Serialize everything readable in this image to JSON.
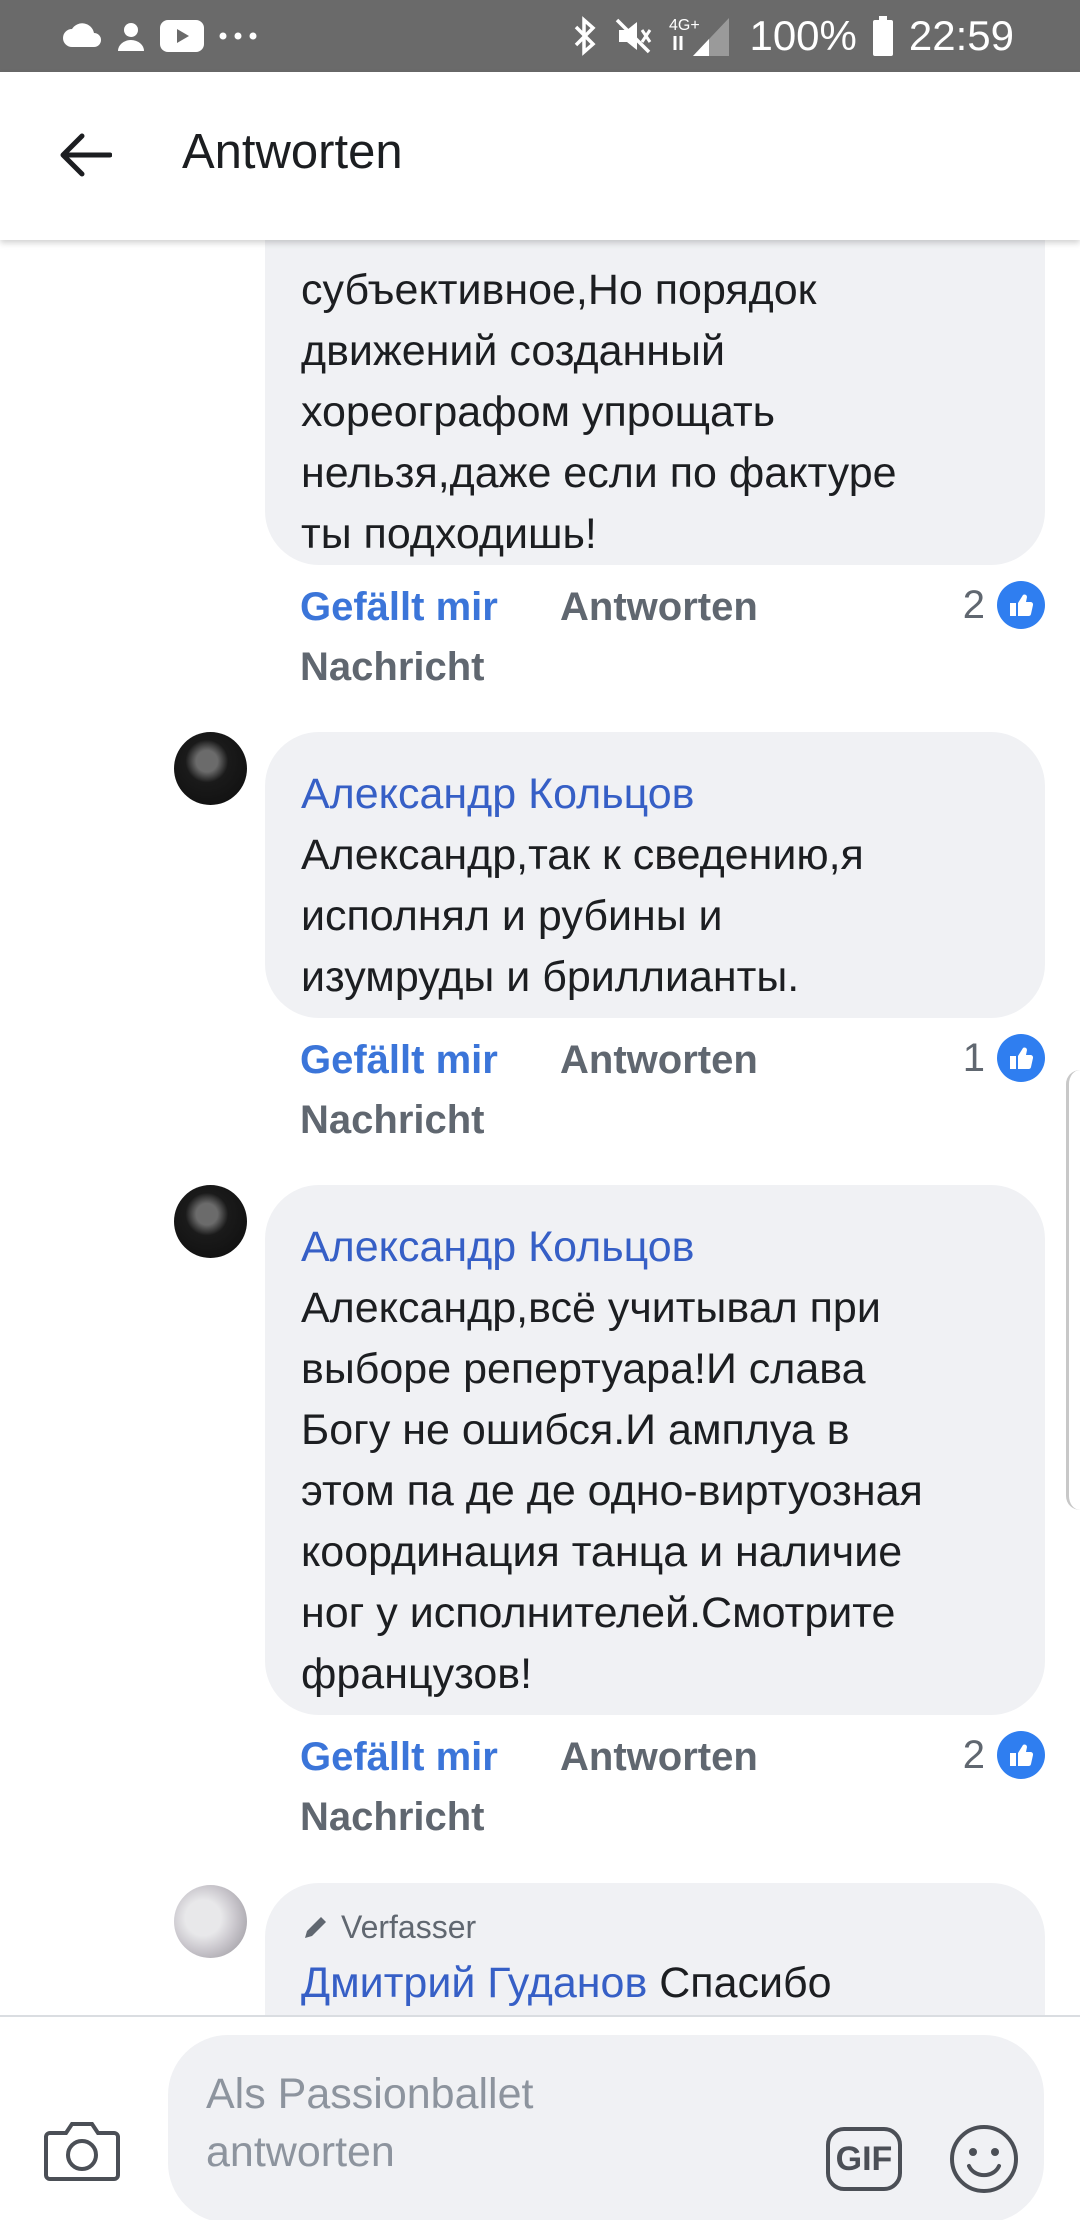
{
  "status_bar": {
    "network": "4G+",
    "battery": "100%",
    "time": "22:59",
    "left_icons": [
      "cloud-icon",
      "person-icon",
      "youtube-icon",
      "more-icon"
    ],
    "right_icons": [
      "bluetooth-icon",
      "mute-icon",
      "signal-icon",
      "battery-icon"
    ]
  },
  "header": {
    "title": "Antworten"
  },
  "comments": [
    {
      "author": "",
      "text": "субъективное,Но порядок\nдвижений созданный\nхореографом упрощать\nнельзя,даже если по фактуре\nты подходишь!",
      "actions": {
        "like": "Gefällt mir",
        "reply": "Antworten",
        "message": "Nachricht"
      },
      "reaction_count": "2"
    },
    {
      "author": "Александр Кольцов",
      "text": "Александр,так к сведению,я\nисполнял и рубины и\nизумруды и бриллианты.",
      "actions": {
        "like": "Gefällt mir",
        "reply": "Antworten",
        "message": "Nachricht"
      },
      "reaction_count": "1"
    },
    {
      "author": "Александр Кольцов",
      "text": "Александр,всё учитывал при\nвыборе репертуара!И слава\nБогу не ошибся.И амплуа в\nэтом па де де одно-виртуозная\nкоординация танца и наличие\nног у исполнителей.Смотрите\nфранцузов!",
      "actions": {
        "like": "Gefällt mir",
        "reply": "Antworten",
        "message": "Nachricht"
      },
      "reaction_count": "2"
    },
    {
      "badge": "Verfasser",
      "author": "Дмитрий Гуданов",
      "text": "Спасибо"
    }
  ],
  "composer": {
    "placeholder": "Als Passionballet\nantworten",
    "gif_label": "GIF"
  }
}
